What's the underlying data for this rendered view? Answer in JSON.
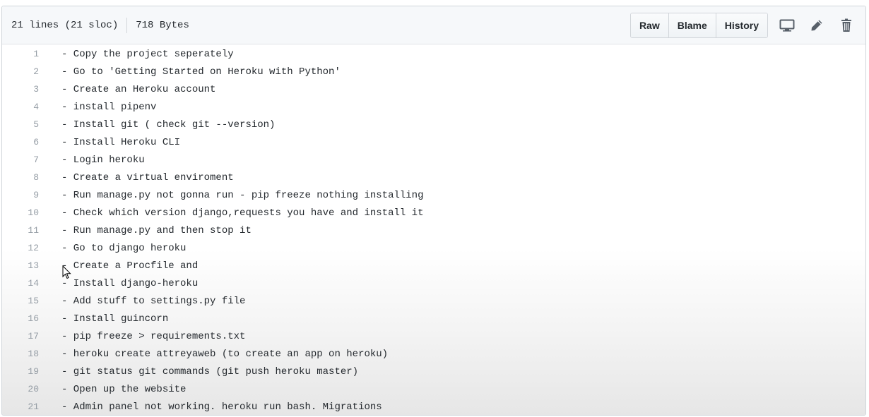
{
  "file_info": {
    "lines": "21 lines (21 sloc)",
    "size": "718 Bytes"
  },
  "toolbar": {
    "raw_label": "Raw",
    "blame_label": "Blame",
    "history_label": "History"
  },
  "icons": {
    "desktop": "desktop-icon",
    "edit": "pencil-icon",
    "delete": "trash-icon"
  },
  "lines": [
    {
      "num": "1",
      "text": "- Copy the project seperately"
    },
    {
      "num": "2",
      "text": "- Go to 'Getting Started on Heroku with Python'"
    },
    {
      "num": "3",
      "text": "- Create an Heroku account"
    },
    {
      "num": "4",
      "text": "- install pipenv"
    },
    {
      "num": "5",
      "text": "- Install git ( check git --version)"
    },
    {
      "num": "6",
      "text": "- Install Heroku CLI"
    },
    {
      "num": "7",
      "text": "- Login heroku"
    },
    {
      "num": "8",
      "text": "- Create a virtual enviroment"
    },
    {
      "num": "9",
      "text": "- Run manage.py not gonna run - pip freeze nothing installing"
    },
    {
      "num": "10",
      "text": "- Check which version django,requests you have and install it"
    },
    {
      "num": "11",
      "text": "- Run manage.py and then stop it"
    },
    {
      "num": "12",
      "text": "- Go to django heroku"
    },
    {
      "num": "13",
      "text": "- Create a Procfile and"
    },
    {
      "num": "14",
      "text": "- Install django-heroku"
    },
    {
      "num": "15",
      "text": "- Add stuff to settings.py file"
    },
    {
      "num": "16",
      "text": "- Install guincorn"
    },
    {
      "num": "17",
      "text": "- pip freeze > requirements.txt"
    },
    {
      "num": "18",
      "text": "- heroku create attreyaweb (to create an app on heroku)"
    },
    {
      "num": "19",
      "text": "- git status git commands (git push heroku master)"
    },
    {
      "num": "20",
      "text": "- Open up the website"
    },
    {
      "num": "21",
      "text": "- Admin panel not working. heroku run bash. Migrations"
    }
  ],
  "colors": {
    "header_bg": "#f6f8fa",
    "border": "#d1d5da",
    "text": "#24292e",
    "line_number": "#959da5"
  }
}
